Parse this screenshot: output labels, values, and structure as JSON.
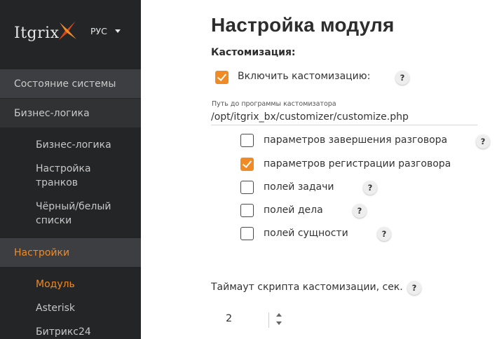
{
  "brand": {
    "logo_text": "Itgrix",
    "accent_color": "#f08a24"
  },
  "language": {
    "current": "РУС"
  },
  "sidebar": {
    "sections": [
      {
        "label": "Состояние системы"
      },
      {
        "label": "Бизнес-логика"
      },
      {
        "label": "Настройки"
      }
    ],
    "business_items": [
      {
        "label": "Бизнес-логика"
      },
      {
        "label_line1": "Настройка",
        "label_line2": "транков"
      },
      {
        "label_line1": "Чёрный/белый",
        "label_line2": "списки"
      }
    ],
    "settings_items": [
      {
        "label": "Модуль",
        "active": true
      },
      {
        "label": "Asterisk"
      },
      {
        "label": "Битрикс24"
      }
    ]
  },
  "main": {
    "title": "Настройка модуля",
    "section_title": "Кастомизация:",
    "enable_customization": {
      "label": "Включить кастомизацию:",
      "checked": true
    },
    "path": {
      "label": "Путь до программы кастомизатора",
      "value": "/opt/itgrix_bx/customizer/customize.php"
    },
    "options": [
      {
        "label": "параметров завершения разговора",
        "checked": false
      },
      {
        "label": "параметров регистрации разговора",
        "checked": true
      },
      {
        "label": "полей задачи",
        "checked": false
      },
      {
        "label": "полей дела",
        "checked": false
      },
      {
        "label": "полей сущности",
        "checked": false
      }
    ],
    "timeout": {
      "label": "Таймаут скрипта кастомизации, сек.",
      "value": "2"
    },
    "help_symbol": "?"
  }
}
